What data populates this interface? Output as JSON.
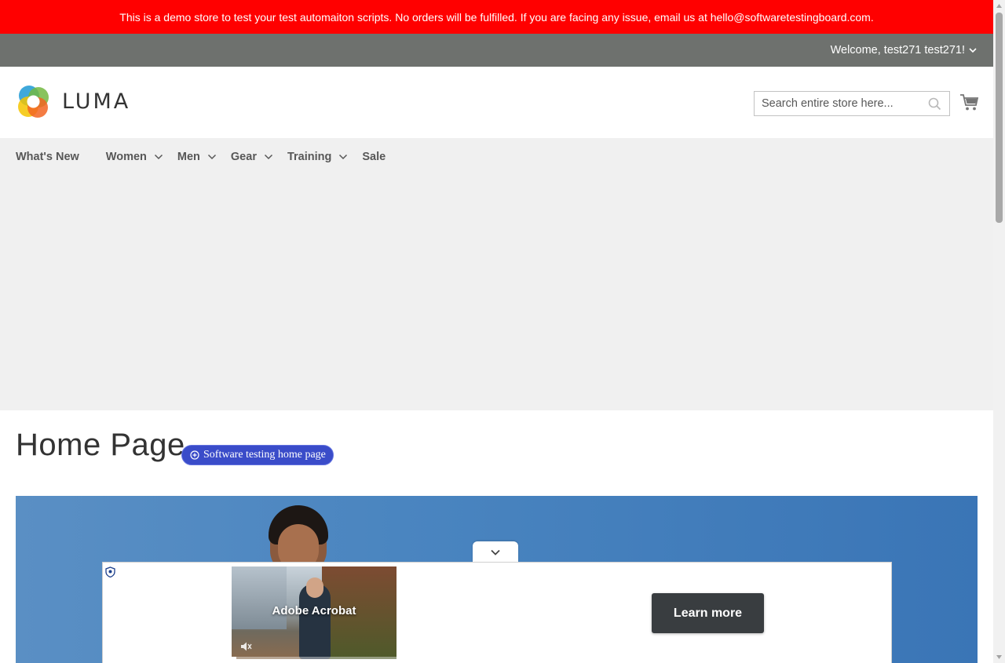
{
  "banner": {
    "text": "This is a demo store to test your test automaiton scripts. No orders will be fulfilled. If you are facing any issue, email us at hello@softwaretestingboard.com."
  },
  "header": {
    "welcome": "Welcome, test271 test271!"
  },
  "logo": {
    "text": "LUMA"
  },
  "search": {
    "placeholder": "Search entire store here...",
    "value": ""
  },
  "nav": {
    "items": [
      {
        "label": "What's New",
        "submenu": false
      },
      {
        "label": "Women",
        "submenu": true
      },
      {
        "label": "Men",
        "submenu": true
      },
      {
        "label": "Gear",
        "submenu": true
      },
      {
        "label": "Training",
        "submenu": true
      },
      {
        "label": "Sale",
        "submenu": false
      }
    ]
  },
  "page": {
    "title": "Home Page",
    "badge": "Software testing home page"
  },
  "ad": {
    "video_title": "Adobe Acrobat",
    "cta": "Learn more",
    "progress": 0.03
  },
  "colors": {
    "banner": "#ff0000",
    "panel": "#6e716e",
    "nav_bg": "#f0f0f0",
    "badge": "#3a4cc9",
    "cta": "#393d40"
  }
}
